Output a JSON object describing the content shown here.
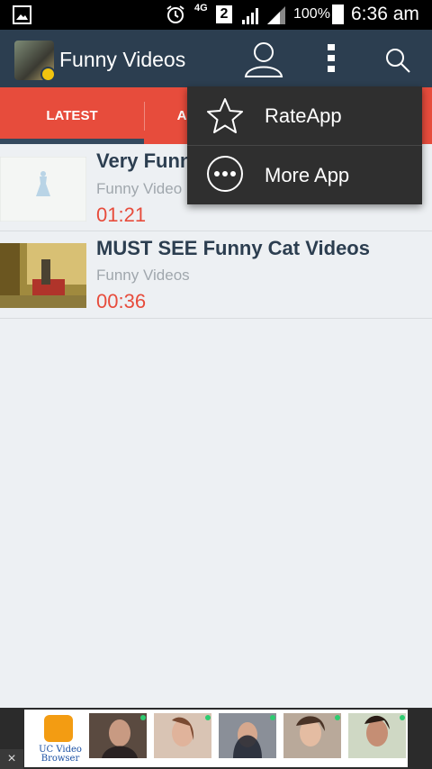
{
  "status_bar": {
    "network": "4G",
    "sim": "2",
    "battery_pct": "100%",
    "time": "6:36 am",
    "icons": [
      "image-icon",
      "alarm-icon",
      "signal-icon",
      "battery-icon"
    ]
  },
  "app_bar": {
    "title": "Funny Videos",
    "icons": [
      "app-logo",
      "profile-icon",
      "overflow-menu-icon",
      "search-icon"
    ]
  },
  "tabs": [
    {
      "label": "LATEST",
      "selected": true
    },
    {
      "label": "A"
    }
  ],
  "videos": [
    {
      "title": "Very Funn",
      "channel": "Funny Video",
      "duration": "01:21"
    },
    {
      "title": "MUST SEE Funny Cat Videos",
      "channel": "Funny Videos",
      "duration": "00:36"
    }
  ],
  "menu": {
    "items": [
      {
        "label": "RateApp",
        "icon": "star-icon"
      },
      {
        "label": "More App",
        "icon": "more-dots-icon"
      }
    ]
  },
  "ad": {
    "brand_line1": "UC Video",
    "brand_line2": "Browser",
    "close": "×"
  },
  "colors": {
    "app_bar": "#2c3e50",
    "tabs": "#e74c3c",
    "duration": "#e74c3c",
    "menu_bg": "#2f2f2f",
    "list_bg": "#edf0f3"
  }
}
